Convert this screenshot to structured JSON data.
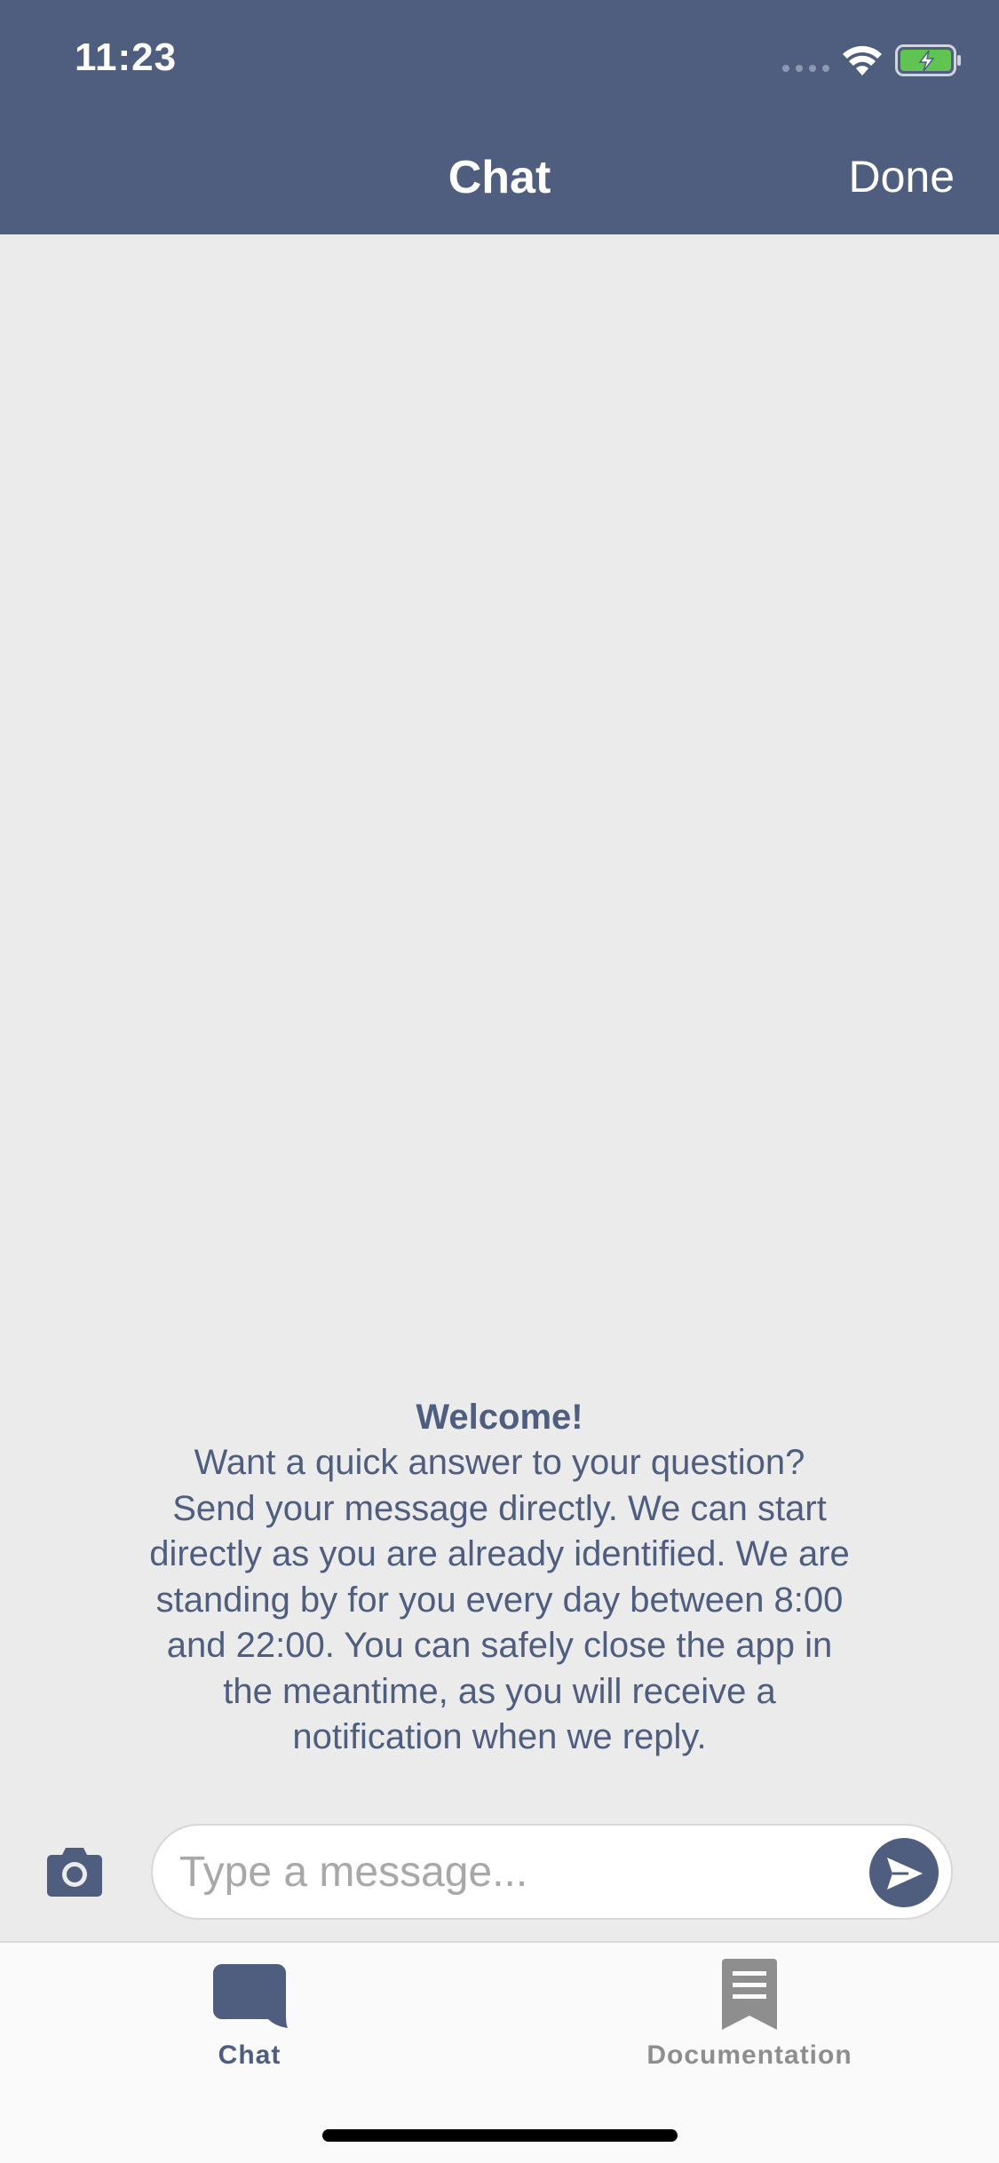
{
  "status_bar": {
    "time": "11:23"
  },
  "nav": {
    "title": "Chat",
    "done_label": "Done"
  },
  "welcome": {
    "title": "Welcome!",
    "lines": [
      "Want a quick answer to your question?",
      "Send your message directly. We can start",
      "directly as you are already identified. We are",
      "standing by for you every day between 8:00",
      "and 22:00. You can safely close the app in",
      "the meantime, as you will receive a",
      "notification when we reply."
    ]
  },
  "composer": {
    "placeholder": "Type a message...",
    "value": "",
    "camera_icon": "camera-icon",
    "send_icon": "send-icon"
  },
  "tabs": [
    {
      "label": "Chat",
      "icon": "chat-bubble-icon",
      "selected": true
    },
    {
      "label": "Documentation",
      "icon": "document-icon",
      "selected": false
    }
  ],
  "colors": {
    "brand": "#4f5e7f",
    "background": "#ebebeb",
    "battery_fill": "#5fc452",
    "inactive_tab": "#8e8e8e"
  }
}
